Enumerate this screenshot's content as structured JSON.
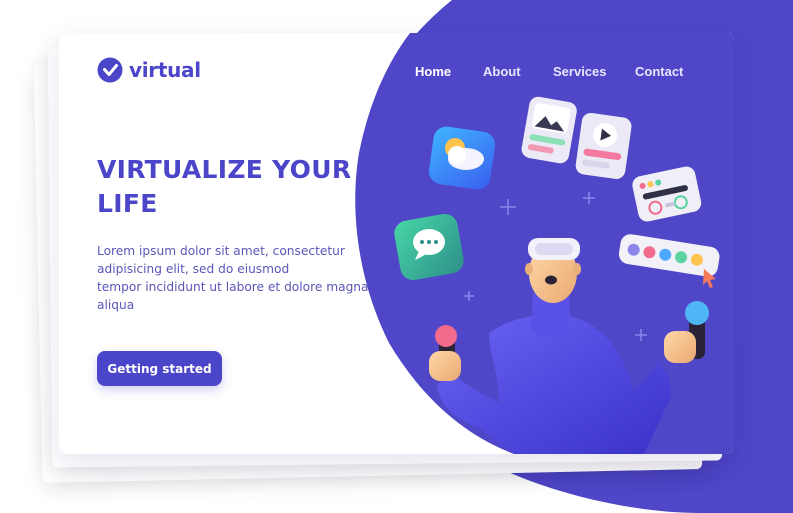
{
  "brand": {
    "name": "virtual",
    "accent": "#4b45c9",
    "blob_color": "#4f46c8"
  },
  "nav": {
    "items": [
      "Home",
      "About",
      "Services",
      "Contact"
    ]
  },
  "hero": {
    "headline_line1": "VIRTUALIZE YOUR",
    "headline_line2": "LIFE",
    "lede_line1": "Lorem ipsum dolor sit amet, consectetur",
    "lede_line2": "adipisicing elit, sed do eiusmod",
    "lede_line3": "tempor incididunt ut labore et dolore magna",
    "lede_line4": "aliqua",
    "cta_label": "Getting started"
  },
  "illustration": {
    "icons": [
      "weather-app-icon",
      "chat-app-icon",
      "gallery-card-icon",
      "video-card-icon",
      "settings-card-icon",
      "color-palette-bar-icon"
    ],
    "figure": "vr-person-with-controllers"
  }
}
